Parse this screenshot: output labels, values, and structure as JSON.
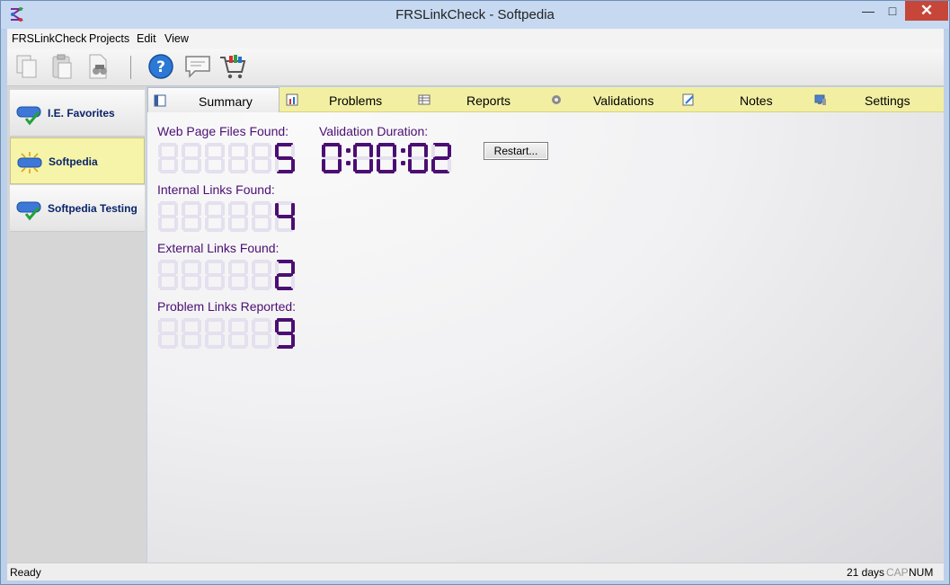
{
  "window": {
    "title": "FRSLinkCheck - Softpedia",
    "minimize": "—",
    "maximize": "□",
    "close": "✕"
  },
  "menu": [
    "FRSLinkCheck",
    "Projects",
    "Edit",
    "View"
  ],
  "toolbar": [
    "copy-icon",
    "paste-icon",
    "find-icon",
    "help-icon",
    "comment-icon",
    "cart-icon"
  ],
  "sidebar": {
    "items": [
      {
        "label": "I.E. Favorites",
        "icon": "checked-project-icon",
        "selected": false
      },
      {
        "label": "Softpedia",
        "icon": "active-project-icon",
        "selected": true
      },
      {
        "label": "Softpedia Testing",
        "icon": "checked-project-icon",
        "selected": false
      }
    ]
  },
  "tabs": [
    {
      "label": "Summary",
      "icon": "summary-icon",
      "active": true
    },
    {
      "label": "Problems",
      "icon": "problems-icon",
      "active": false
    },
    {
      "label": "Reports",
      "icon": "reports-icon",
      "active": false
    },
    {
      "label": "Validations",
      "icon": "gear-icon",
      "active": false
    },
    {
      "label": "Notes",
      "icon": "notes-icon",
      "active": false
    },
    {
      "label": "Settings",
      "icon": "settings-icon",
      "active": false
    }
  ],
  "summary": {
    "web_page_files_label": "Web Page Files Found:",
    "web_page_files_value": "5",
    "internal_links_label": "Internal Links Found:",
    "internal_links_value": "4",
    "external_links_label": "External Links Found:",
    "external_links_value": "2",
    "problem_links_label": "Problem Links Reported:",
    "problem_links_value": "9",
    "duration_label": "Validation Duration:",
    "duration_value": "0:00:02",
    "restart_label": "Restart..."
  },
  "status": {
    "text": "Ready",
    "days": "21 days",
    "cap": "CAP",
    "num": "NUM"
  },
  "colors": {
    "lcd_on": "#4b0f73",
    "lcd_off": "#e4e0ee",
    "tab_bar": "#f2efa3",
    "close": "#c7463a"
  }
}
